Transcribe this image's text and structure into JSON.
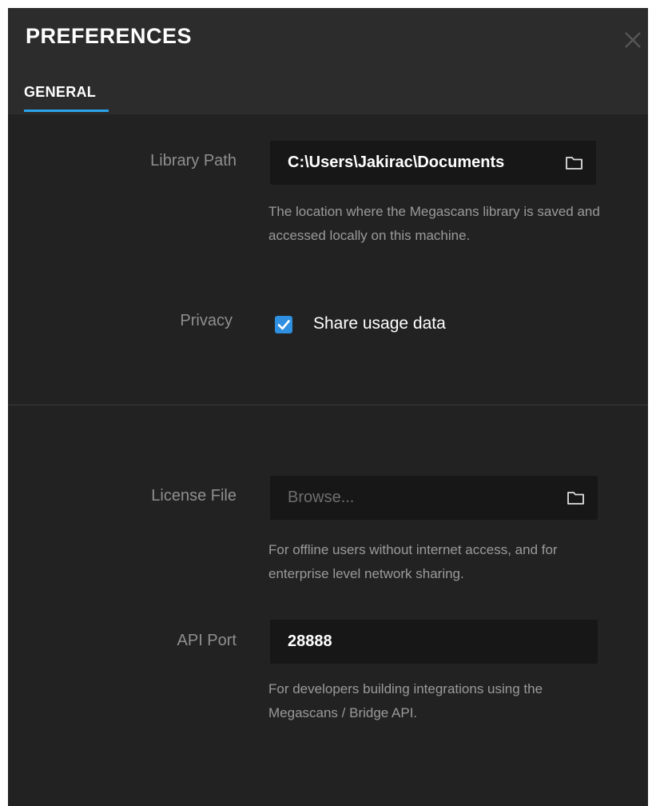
{
  "dialog": {
    "title": "PREFERENCES",
    "close_icon": "close-icon",
    "tabs": [
      {
        "label": "GENERAL",
        "active": true
      }
    ]
  },
  "general": {
    "library_path": {
      "label": "Library Path",
      "value": "C:\\Users\\Jakirac\\Documents",
      "icon": "folder-icon",
      "help": "The location where the Megascans library is saved and accessed locally on this machine."
    },
    "privacy": {
      "label": "Privacy",
      "checkbox_label": "Share usage data",
      "checked": true
    },
    "license_file": {
      "label": "License File",
      "placeholder": "Browse...",
      "icon": "folder-icon",
      "help": "For offline users without internet access, and for enterprise level network sharing."
    },
    "api_port": {
      "label": "API Port",
      "value": "28888",
      "help": "For developers building integrations using the Megascans / Bridge API."
    }
  },
  "colors": {
    "accent": "#2aa4ea",
    "checkbox": "#2f8fe0",
    "background": "#222222",
    "header": "#2c2c2c",
    "field": "#171717"
  }
}
